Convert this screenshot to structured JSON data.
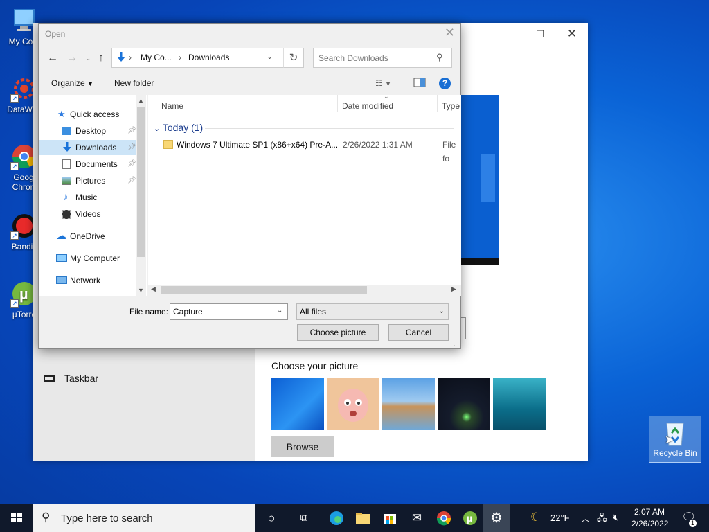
{
  "desktop": {
    "icons": [
      {
        "label": "My Com",
        "icon": "computer-icon"
      },
      {
        "label": "DataWag",
        "icon": "datawag-icon"
      },
      {
        "label": "Goog Chron",
        "icon": "chrome-icon"
      },
      {
        "label": "Bandic",
        "icon": "bandicam-icon"
      },
      {
        "label": "µTorre",
        "icon": "utorrent-icon"
      }
    ],
    "recycle_bin": "Recycle Bin"
  },
  "settings_window": {
    "taskbar_label": "Taskbar",
    "choose_picture_title": "Choose your picture",
    "browse_label": "Browse",
    "thumbnails": [
      "windows-blue",
      "cartoon-character",
      "rock-beach",
      "night-sky-tent",
      "underwater-swimmer"
    ]
  },
  "dialog": {
    "title": "Open",
    "breadcrumb": [
      "My Co...",
      "Downloads"
    ],
    "search_placeholder": "Search Downloads",
    "toolbar": {
      "organize": "Organize",
      "new_folder": "New folder",
      "help": "?"
    },
    "nav": {
      "quick_access": "Quick access",
      "desktop": "Desktop",
      "downloads": "Downloads",
      "documents": "Documents",
      "pictures": "Pictures",
      "music": "Music",
      "videos": "Videos",
      "onedrive": "OneDrive",
      "my_computer": "My Computer",
      "network": "Network"
    },
    "columns": {
      "name": "Name",
      "date_modified": "Date modified",
      "type": "Type"
    },
    "group": "Today (1)",
    "files": [
      {
        "name": "Windows 7 Ultimate SP1 (x86+x64) Pre-A...",
        "date": "2/26/2022 1:31 AM",
        "type": "File fo"
      }
    ],
    "file_name_label": "File name:",
    "file_name_value": "Capture",
    "file_type": "All files",
    "choose_button": "Choose picture",
    "cancel_button": "Cancel"
  },
  "taskbar": {
    "search_placeholder": "Type here to search",
    "weather": "22°F",
    "time": "2:07 AM",
    "date": "2/26/2022",
    "notification_count": "1"
  },
  "colors": {
    "accent": "#0078d7",
    "taskbar": "#10192b",
    "selection": "#cce4f7",
    "group_header": "#1e3f8f"
  }
}
